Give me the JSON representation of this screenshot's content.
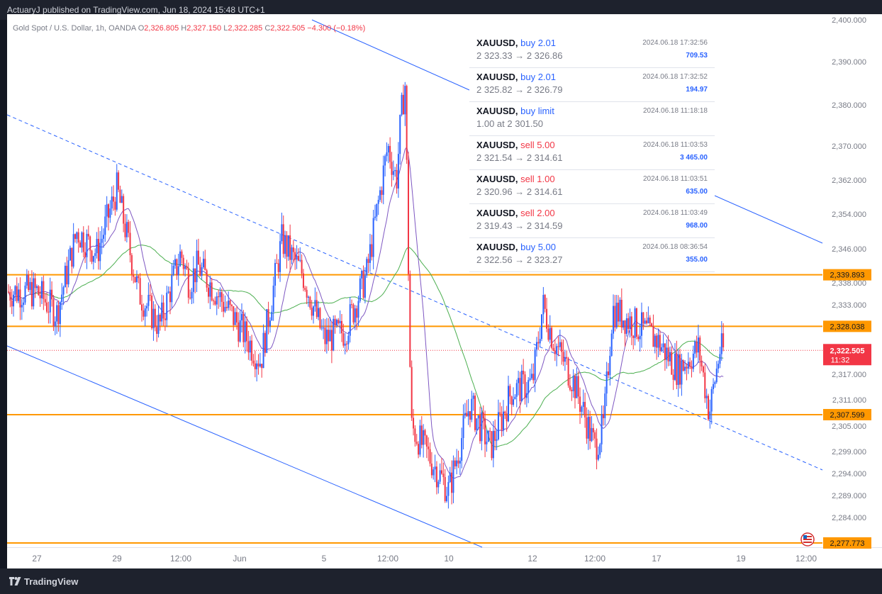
{
  "header": {
    "publisher": "ActuaryJ published on TradingView.com, Jun 18, 2024 15:48 UTC+1"
  },
  "legend": {
    "symbol": "Gold Spot / U.S. Dollar, 1h, OANDA",
    "o_label": "O",
    "o_value": "2,326.805",
    "h_label": "H",
    "h_value": "2,327.150",
    "l_label": "L",
    "l_value": "2,322.285",
    "c_label": "C",
    "c_value": "2,322.505",
    "change": "−4.300 (−0.18%)"
  },
  "trades": [
    {
      "symbol": "XAUUSD,",
      "action": "buy 2.01",
      "side": "buy",
      "prices": "2 323.33 → 2 326.86",
      "date": "2024.06.18 17:32:56",
      "profit": "709.53"
    },
    {
      "symbol": "XAUUSD,",
      "action": "buy 2.01",
      "side": "buy",
      "prices": "2 325.82 → 2 326.79",
      "date": "2024.06.18 17:32:52",
      "profit": "194.97"
    },
    {
      "symbol": "XAUUSD,",
      "action": "buy limit",
      "side": "buy",
      "prices": "1.00 at 2 301.50",
      "date": "2024.06.18 11:18:18",
      "profit": ""
    },
    {
      "symbol": "XAUUSD,",
      "action": "sell 5.00",
      "side": "sell",
      "prices": "2 321.54 → 2 314.61",
      "date": "2024.06.18 11:03:53",
      "profit": "3 465.00"
    },
    {
      "symbol": "XAUUSD,",
      "action": "sell 1.00",
      "side": "sell",
      "prices": "2 320.96 → 2 314.61",
      "date": "2024.06.18 11:03:51",
      "profit": "635.00"
    },
    {
      "symbol": "XAUUSD,",
      "action": "sell 2.00",
      "side": "sell",
      "prices": "2 319.43 → 2 314.59",
      "date": "2024.06.18 11:03:49",
      "profit": "968.00"
    },
    {
      "symbol": "XAUUSD,",
      "action": "buy 5.00",
      "side": "buy",
      "prices": "2 322.56 → 2 323.27",
      "date": "2024.06.18 08:36:54",
      "profit": "355.00"
    }
  ],
  "footer": {
    "brand": "TradingView"
  },
  "colors": {
    "up": "#2962ff",
    "down": "#f23645",
    "level": "#ff9800",
    "ma_fast": "#7e57c2",
    "ma_slow": "#4caf50",
    "trend": "#2962ff"
  },
  "chart_data": {
    "type": "candlestick",
    "title": "Gold Spot / U.S. Dollar, 1h, OANDA",
    "y_ticks": [
      {
        "value": 2400,
        "label": "2,400.000"
      },
      {
        "value": 2390,
        "label": "2,390.000"
      },
      {
        "value": 2380,
        "label": "2,380.000"
      },
      {
        "value": 2370,
        "label": "2,370.000"
      },
      {
        "value": 2362,
        "label": "2,362.000"
      },
      {
        "value": 2354,
        "label": "2,354.000"
      },
      {
        "value": 2346,
        "label": "2,346.000"
      },
      {
        "value": 2338,
        "label": "2,338.000"
      },
      {
        "value": 2333,
        "label": "2,333.000"
      },
      {
        "value": 2317,
        "label": "2,317.000"
      },
      {
        "value": 2311,
        "label": "2,311.000"
      },
      {
        "value": 2305,
        "label": "2,305.000"
      },
      {
        "value": 2299,
        "label": "2,299.000"
      },
      {
        "value": 2294,
        "label": "2,294.000"
      },
      {
        "value": 2289,
        "label": "2,289.000"
      },
      {
        "value": 2284,
        "label": "2,284.000"
      }
    ],
    "x_ticks": [
      {
        "label": "27",
        "date": "2024-05-27"
      },
      {
        "label": "29",
        "date": "2024-05-29"
      },
      {
        "label": "12:00",
        "date": "2024-05-30 12:00"
      },
      {
        "label": "Jun",
        "date": "2024-06-03"
      },
      {
        "label": "5",
        "date": "2024-06-05"
      },
      {
        "label": "12:00",
        "date": "2024-06-06 12:00"
      },
      {
        "label": "10",
        "date": "2024-06-10"
      },
      {
        "label": "12",
        "date": "2024-06-12"
      },
      {
        "label": "12:00",
        "date": "2024-06-13 12:00"
      },
      {
        "label": "17",
        "date": "2024-06-17"
      },
      {
        "label": "19",
        "date": "2024-06-19"
      },
      {
        "label": "12:00",
        "date": "2024-06-19 12:00"
      }
    ],
    "levels": [
      {
        "value": 2339.893,
        "label": "2,339.893"
      },
      {
        "value": 2328.038,
        "label": "2,328.038"
      },
      {
        "value": 2307.599,
        "label": "2,307.599"
      },
      {
        "value": 2277.773,
        "label": "2,277.773"
      }
    ],
    "last_price": {
      "label": "2,322.505",
      "countdown": "11:32"
    },
    "close_path": [
      {
        "date": "2024-05-27",
        "price": 2336
      },
      {
        "date": "2024-05-27 12:00",
        "price": 2331
      },
      {
        "date": "2024-05-28",
        "price": 2350
      },
      {
        "date": "2024-05-28 12:00",
        "price": 2345
      },
      {
        "date": "2024-05-29",
        "price": 2360
      },
      {
        "date": "2024-05-29 12:00",
        "price": 2336
      },
      {
        "date": "2024-05-30",
        "price": 2328
      },
      {
        "date": "2024-05-30 12:00",
        "price": 2345
      },
      {
        "date": "2024-05-31",
        "price": 2338
      },
      {
        "date": "2024-05-31 12:00",
        "price": 2342
      },
      {
        "date": "2024-06-03",
        "price": 2328
      },
      {
        "date": "2024-06-03 12:00",
        "price": 2320
      },
      {
        "date": "2024-06-04",
        "price": 2348
      },
      {
        "date": "2024-06-04 12:00",
        "price": 2340
      },
      {
        "date": "2024-06-05",
        "price": 2325
      },
      {
        "date": "2024-06-05 12:00",
        "price": 2327
      },
      {
        "date": "2024-06-06",
        "price": 2340
      },
      {
        "date": "2024-06-06 12:00",
        "price": 2370
      },
      {
        "date": "2024-06-07",
        "price": 2362
      },
      {
        "date": "2024-06-07 06:00",
        "price": 2377
      },
      {
        "date": "2024-06-07 12:00",
        "price": 2385
      },
      {
        "date": "2024-06-07 16:00",
        "price": 2345
      },
      {
        "date": "2024-06-07 20:00",
        "price": 2305
      },
      {
        "date": "2024-06-10",
        "price": 2290
      },
      {
        "date": "2024-06-10 12:00",
        "price": 2310
      },
      {
        "date": "2024-06-11",
        "price": 2300
      },
      {
        "date": "2024-06-11 12:00",
        "price": 2313
      },
      {
        "date": "2024-06-12",
        "price": 2315
      },
      {
        "date": "2024-06-12 06:00",
        "price": 2333
      },
      {
        "date": "2024-06-12 12:00",
        "price": 2325
      },
      {
        "date": "2024-06-13",
        "price": 2315
      },
      {
        "date": "2024-06-13 12:00",
        "price": 2300
      },
      {
        "date": "2024-06-14",
        "price": 2305
      },
      {
        "date": "2024-06-14 12:00",
        "price": 2332
      },
      {
        "date": "2024-06-17",
        "price": 2325
      },
      {
        "date": "2024-06-17 12:00",
        "price": 2318
      },
      {
        "date": "2024-06-18",
        "price": 2323
      },
      {
        "date": "2024-06-18 06:00",
        "price": 2308
      },
      {
        "date": "2024-06-18 12:00",
        "price": 2322.5
      }
    ]
  }
}
